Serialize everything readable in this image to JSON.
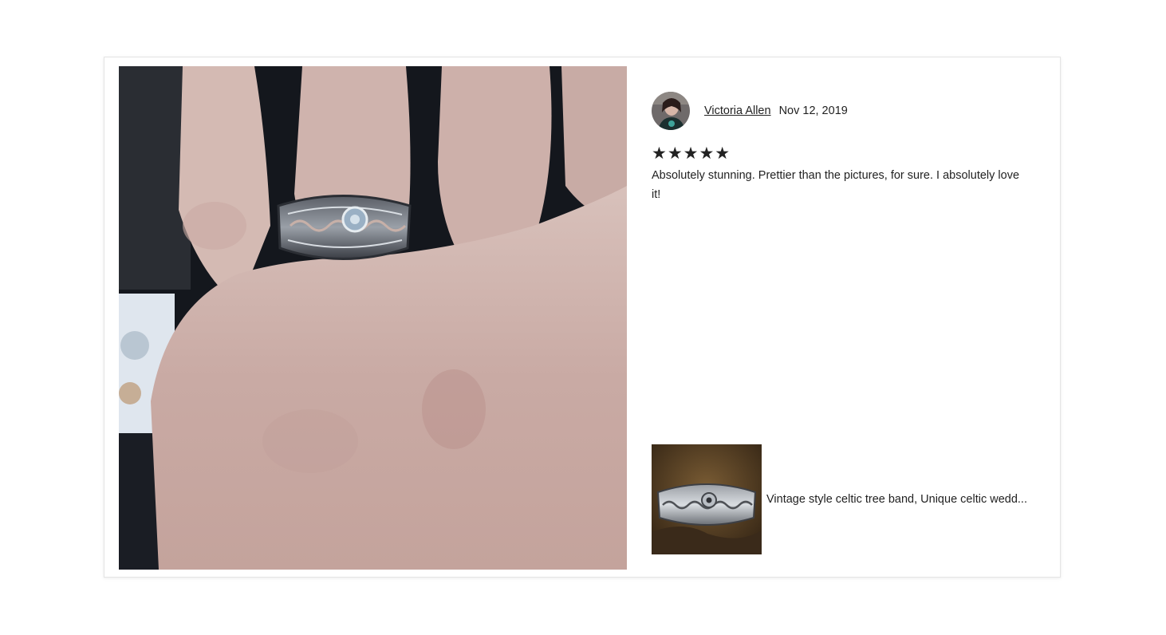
{
  "review": {
    "reviewer_name": "Victoria Allen",
    "date": "Nov 12, 2019",
    "rating": 5,
    "stars_text": "★★★★★",
    "text": "Absolutely stunning. Prettier than the pictures, for sure. I absolutely love it!"
  },
  "listing": {
    "title": "Vintage style celtic tree band, Unique celtic wedd..."
  },
  "colors": {
    "text": "#222222",
    "card_border": "#e4e4e4",
    "star": "#222222"
  }
}
